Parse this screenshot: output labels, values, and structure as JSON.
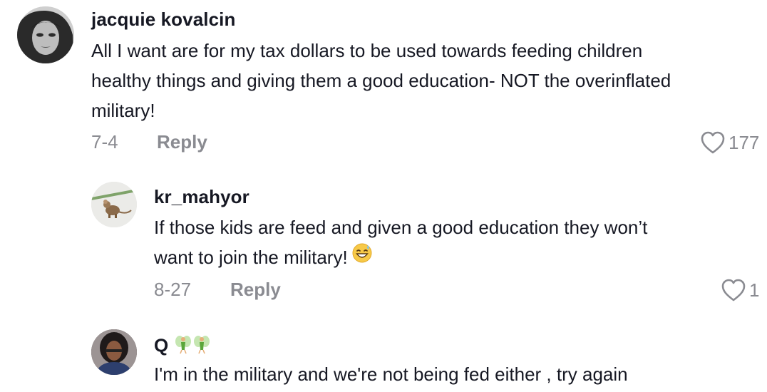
{
  "comments": [
    {
      "username": "jacquie kovalcin",
      "lines": [
        "All I want are for my tax dollars to be used towards feeding children",
        "healthy things and giving them a good education- NOT the overinflated",
        "military!"
      ],
      "date": "7-4",
      "reply_label": "Reply",
      "likes": "177"
    },
    {
      "username": "kr_mahyor",
      "lines": [
        "If those kids are feed and given a good education they won’t",
        "want to join the military!"
      ],
      "emoji": "grinning-sweat-emoji",
      "date": "8-27",
      "reply_label": "Reply",
      "likes": "1"
    },
    {
      "username": "Q",
      "username_badges": [
        "fairy-icon",
        "fairy-icon"
      ],
      "lines": [
        "I'm in the military and we're not being fed either , try again"
      ]
    }
  ],
  "colors": {
    "text": "#161823",
    "muted": "#8a8b91"
  }
}
